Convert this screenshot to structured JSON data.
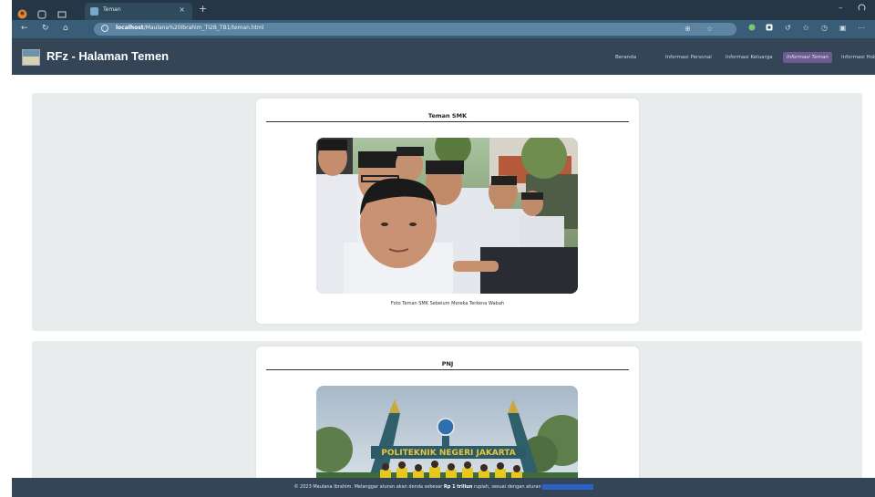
{
  "browser": {
    "tab_title": "Teman",
    "tab_close": "×",
    "new_tab": "+",
    "url_host": "localhost",
    "url_path": "/Maulana%20Ibrahim_TI2B_TB1/teman.html",
    "window_minimize": "–",
    "window_maximize": "□"
  },
  "header": {
    "title": "RFz - Halaman Temen",
    "nav": [
      {
        "label": "Beranda"
      },
      {
        "label": "Informasi Personal"
      },
      {
        "label": "Informasi Keluarga"
      },
      {
        "label": "Informasi Teman",
        "active": true
      },
      {
        "label": "Informasi Hobi"
      }
    ]
  },
  "sections": [
    {
      "title": "Teman SMK",
      "caption": "Foto Teman SMK Sebelum Mereka Terkena Wabah"
    },
    {
      "title": "PNJ",
      "caption": ""
    }
  ],
  "footer": {
    "prefix": "© 2023 Maulana Ibrahim. Melanggar aturan akan denda sebesar",
    "amount": "Rp 1 triliun",
    "suffix": "rupiah, sesuai dengan aturan",
    "link_text": "https://uu.tkp.ahk.ahk"
  },
  "photo_banner_text": "POLITEKNIK NEGERI JAKARTA",
  "colors": {
    "header_bg": "#334556",
    "section_bg": "#e9ecec",
    "active_nav": "#6c5d8f"
  }
}
